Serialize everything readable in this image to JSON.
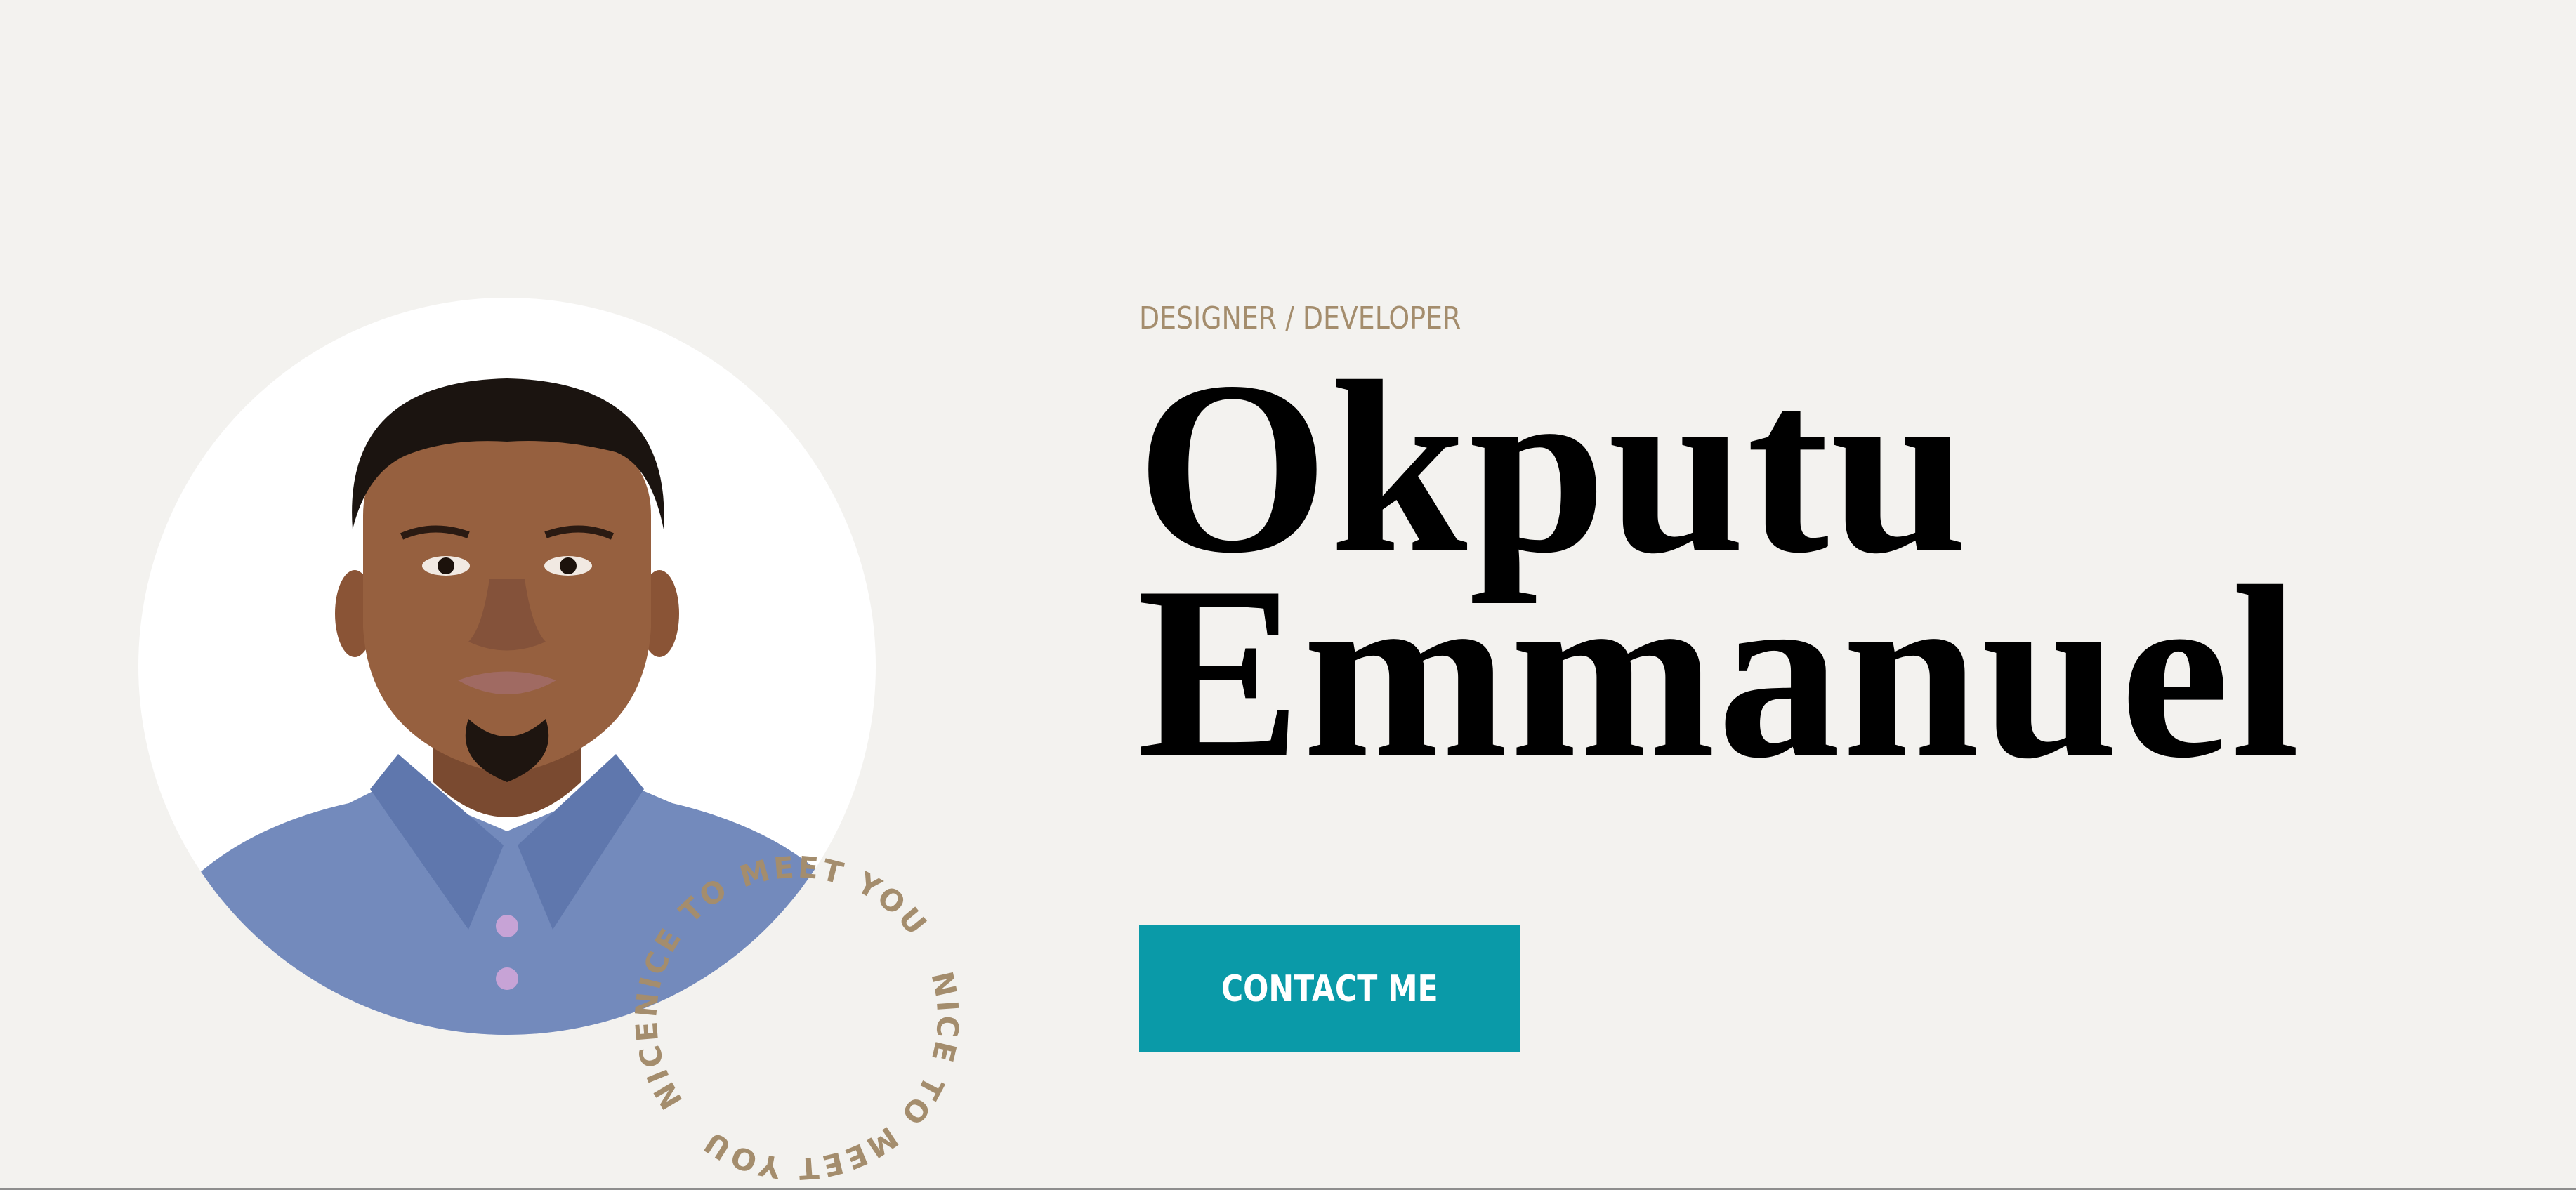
{
  "hero": {
    "tagline": "DESIGNER / DEVELOPER",
    "name_line1": "Okputu",
    "name_line2": "Emmanuel",
    "contact_label": "CONTACT ME",
    "badge_text": "NICE TO MEET YOU",
    "portrait_icon": "person-photo"
  },
  "colors": {
    "background": "#f3f2ef",
    "accent": "#0a9aa8",
    "tagline": "#a48d6d",
    "heading": "#000000"
  }
}
